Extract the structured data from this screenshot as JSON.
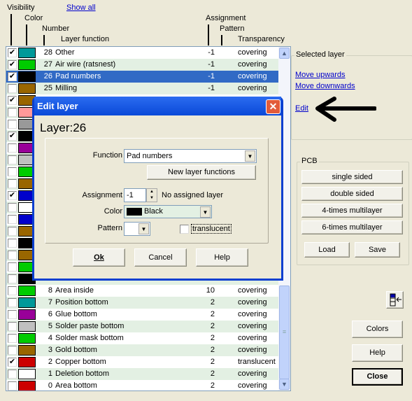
{
  "headers": {
    "visibility": "Visibility",
    "color": "Color",
    "number": "Number",
    "function": "Layer function",
    "assignment": "Assignment",
    "pattern": "Pattern",
    "transparency": "Transparency"
  },
  "show_all": "Show all",
  "layers": [
    {
      "num": "28",
      "func": "Other",
      "assign": "-1",
      "trans": "covering",
      "color": "#009999",
      "visible": true
    },
    {
      "num": "27",
      "func": "Air wire (ratsnest)",
      "assign": "-1",
      "trans": "covering",
      "color": "#00cc00",
      "visible": true
    },
    {
      "num": "26",
      "func": "Pad numbers",
      "assign": "-1",
      "trans": "covering",
      "color": "#000000",
      "visible": true,
      "selected": true
    },
    {
      "num": "25",
      "func": "Milling",
      "assign": "-1",
      "trans": "covering",
      "color": "#996600",
      "visible": false
    },
    {
      "color": "#996600",
      "visible": true
    },
    {
      "color": "#ff9999",
      "visible": false
    },
    {
      "color": "#999999",
      "visible": false
    },
    {
      "color": "#000000",
      "visible": true
    },
    {
      "color": "#990099",
      "visible": false
    },
    {
      "color": "#c0c0c0",
      "visible": false
    },
    {
      "color": "#00cc00",
      "visible": false
    },
    {
      "color": "#996600",
      "visible": false
    },
    {
      "color": "#0000cc",
      "visible": true
    },
    {
      "color": "#ffffff",
      "visible": false
    },
    {
      "color": "#0000cc",
      "visible": false
    },
    {
      "color": "#996600",
      "visible": false
    },
    {
      "color": "#000000",
      "visible": false
    },
    {
      "color": "#996600",
      "visible": false
    },
    {
      "color": "#00cc00",
      "visible": false
    },
    {
      "color": "#000000",
      "visible": false
    },
    {
      "num": "8",
      "func": "Area inside",
      "assign": "10",
      "trans": "covering",
      "color": "#00cc00",
      "visible": false
    },
    {
      "num": "7",
      "func": "Position bottom",
      "assign": "2",
      "trans": "covering",
      "color": "#009999",
      "visible": false
    },
    {
      "num": "6",
      "func": "Glue bottom",
      "assign": "2",
      "trans": "covering",
      "color": "#990099",
      "visible": false
    },
    {
      "num": "5",
      "func": "Solder paste bottom",
      "assign": "2",
      "trans": "covering",
      "color": "#c0c0c0",
      "visible": false
    },
    {
      "num": "4",
      "func": "Solder mask bottom",
      "assign": "2",
      "trans": "covering",
      "color": "#00cc00",
      "visible": false
    },
    {
      "num": "3",
      "func": "Gold bottom",
      "assign": "2",
      "trans": "covering",
      "color": "#996600",
      "visible": false
    },
    {
      "num": "2",
      "func": "Copper bottom",
      "assign": "2",
      "trans": "translucent",
      "color": "#cc0000",
      "visible": true
    },
    {
      "num": "1",
      "func": "Deletion bottom",
      "assign": "2",
      "trans": "covering",
      "color": "#ffffff",
      "visible": false
    },
    {
      "num": "0",
      "func": "Area bottom",
      "assign": "2",
      "trans": "covering",
      "color": "#cc0000",
      "visible": false
    }
  ],
  "selected_layer": {
    "title": "Selected layer",
    "move_up": "Move upwards",
    "move_down": "Move downwards",
    "edit": "Edit"
  },
  "pcb": {
    "title": "PCB",
    "single": "single sided",
    "double": "double sided",
    "four": "4-times multilayer",
    "six": "6-times multilayer",
    "load": "Load",
    "save": "Save"
  },
  "buttons": {
    "colors": "Colors",
    "help": "Help",
    "close": "Close"
  },
  "dialog": {
    "title": "Edit layer",
    "layer": "Layer:26",
    "function_label": "Function",
    "function_value": "Pad numbers",
    "new_functions": "New layer functions",
    "assignment_label": "Assignment",
    "assignment_value": "-1",
    "assignment_note": "No assigned layer",
    "color_label": "Color",
    "color_value": "Black",
    "color_swatch": "#000000",
    "pattern_label": "Pattern",
    "translucent": "translucent",
    "translucent_checked": false,
    "ok": "Ok",
    "cancel": "Cancel",
    "help": "Help"
  }
}
